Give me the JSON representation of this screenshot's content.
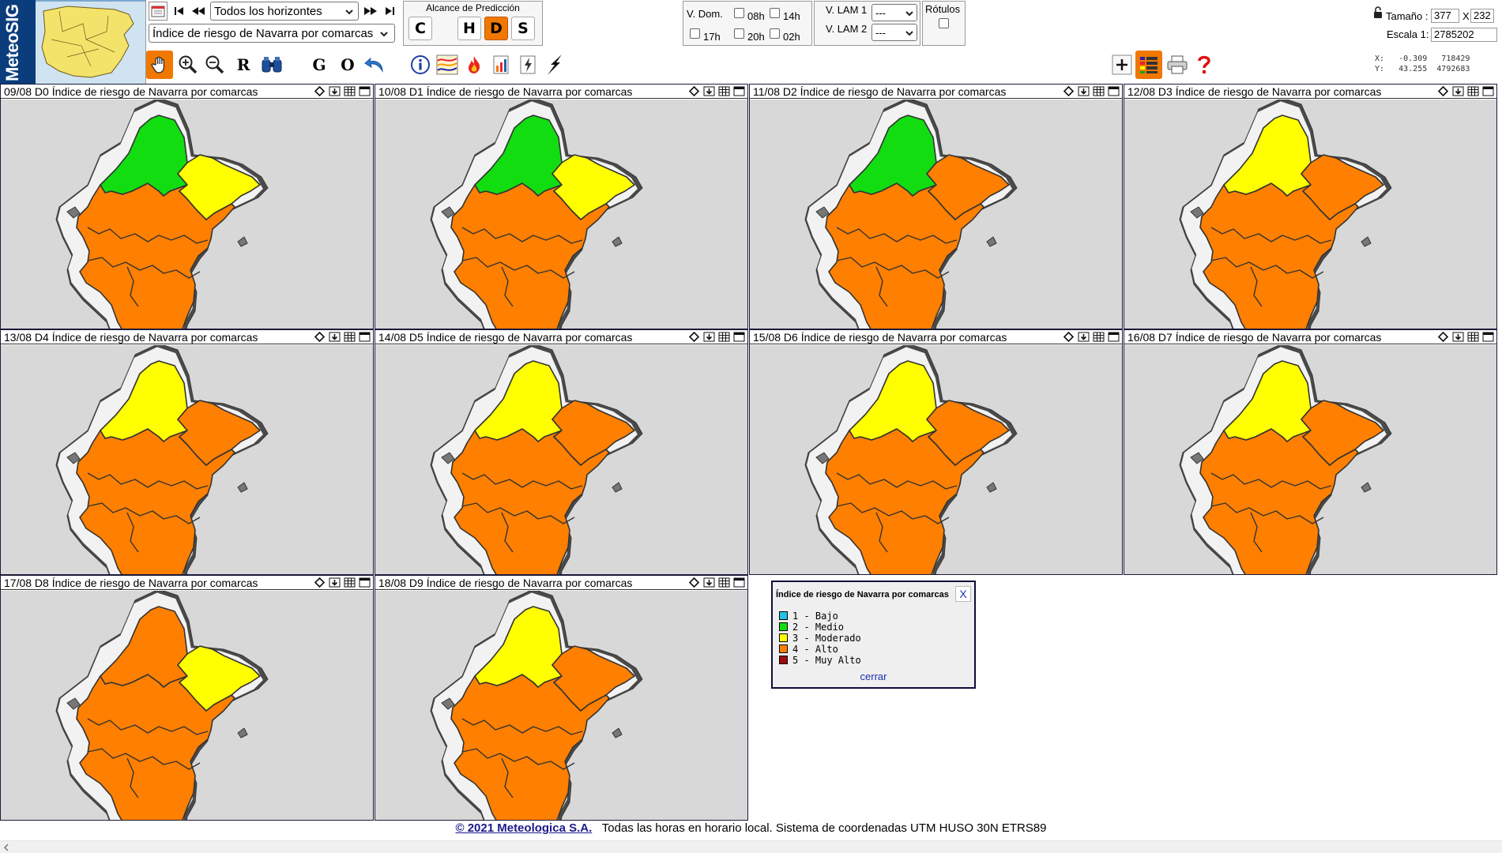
{
  "app": {
    "brand": "MeteoSIG"
  },
  "horizon_select": {
    "value": "Todos los horizontes"
  },
  "layer_select": {
    "value": "Índice de riesgo de Navarra por comarcas"
  },
  "alcance": {
    "title": "Alcance de Predicción",
    "buttons": [
      "C",
      "H",
      "D",
      "S"
    ],
    "active": "D"
  },
  "vdom": {
    "label": "V. Dom.",
    "hours": [
      "08h",
      "14h",
      "17h",
      "20h",
      "02h"
    ]
  },
  "vlam": {
    "lam1_label": "V. LAM 1",
    "lam2_label": "V. LAM 2",
    "lam1_value": "---",
    "lam2_value": "---"
  },
  "rotulos": {
    "label": "Rótulos"
  },
  "size": {
    "label": "Tamaño :",
    "width": "377",
    "sep": "X",
    "height": "232"
  },
  "scale": {
    "label": "Escala 1:",
    "value": "2785202"
  },
  "coords": {
    "x_label": "X:",
    "x_deg": "-0.309",
    "x_utm": "718429",
    "y_label": "Y:",
    "y_deg": "43.255",
    "y_utm": "4792683"
  },
  "toolbar": {
    "text_tools": [
      "R",
      "G",
      "O"
    ]
  },
  "colors": {
    "bajo": "#22c3e8",
    "medio": "#11dd11",
    "moderado": "#ffff00",
    "alto": "#ff7f00",
    "muy_alto": "#9d0d0d",
    "panel_bg": "#d8d8d8",
    "accent": "#f07800"
  },
  "panels": [
    {
      "title": "09/08 D0 Índice de riesgo de Navarra por comarcas",
      "nw": "medio",
      "ne": "moderado",
      "south": "alto"
    },
    {
      "title": "10/08 D1 Índice de riesgo de Navarra por comarcas",
      "nw": "medio",
      "ne": "moderado",
      "south": "alto"
    },
    {
      "title": "11/08 D2 Índice de riesgo de Navarra por comarcas",
      "nw": "medio",
      "ne": "alto",
      "south": "alto"
    },
    {
      "title": "12/08 D3 Índice de riesgo de Navarra por comarcas",
      "nw": "moderado",
      "ne": "alto",
      "south": "alto"
    },
    {
      "title": "13/08 D4 Índice de riesgo de Navarra por comarcas",
      "nw": "moderado",
      "ne": "alto",
      "south": "alto"
    },
    {
      "title": "14/08 D5 Índice de riesgo de Navarra por comarcas",
      "nw": "moderado",
      "ne": "alto",
      "south": "alto"
    },
    {
      "title": "15/08 D6 Índice de riesgo de Navarra por comarcas",
      "nw": "moderado",
      "ne": "alto",
      "south": "alto"
    },
    {
      "title": "16/08 D7 Índice de riesgo de Navarra por comarcas",
      "nw": "moderado",
      "ne": "alto",
      "south": "alto"
    },
    {
      "title": "17/08 D8 Índice de riesgo de Navarra por comarcas",
      "nw": "alto",
      "ne": "moderado",
      "south": "alto"
    },
    {
      "title": "18/08 D9 Índice de riesgo de Navarra por comarcas",
      "nw": "moderado",
      "ne": "alto",
      "south": "alto"
    }
  ],
  "legend": {
    "title": "Índice de riesgo de Navarra por comarcas",
    "close": "X",
    "items": [
      {
        "label": "1 - Bajo",
        "color": "#22c3e8"
      },
      {
        "label": "2 - Medio",
        "color": "#11dd11"
      },
      {
        "label": "3 - Moderado",
        "color": "#ffff00"
      },
      {
        "label": "4 - Alto",
        "color": "#ff7f00"
      },
      {
        "label": "5 - Muy Alto",
        "color": "#9d0d0d"
      }
    ],
    "cerrar": "cerrar"
  },
  "footer": {
    "copyright": "© 2021 Meteologica S.A.",
    "note": "Todas las horas en horario local. Sistema de coordenadas UTM HUSO 30N ETRS89"
  }
}
